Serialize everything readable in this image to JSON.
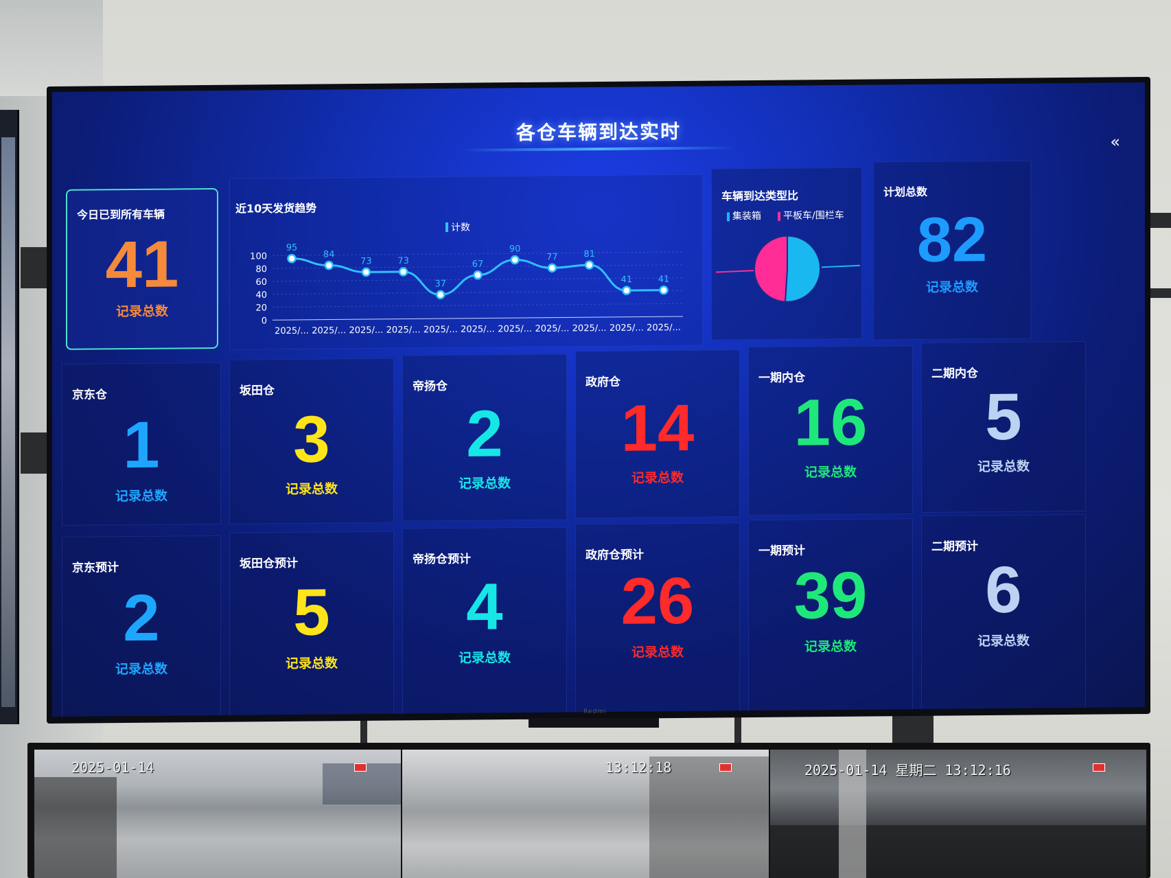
{
  "dashboard": {
    "title": "各仓车辆到达实时",
    "collapse_glyph": "«",
    "tv_brand": "Redmi"
  },
  "today": {
    "title": "今日已到所有车辆",
    "value": "41",
    "label": "记录总数",
    "color": "#f58a3c"
  },
  "trend": {
    "title": "近10天发货趋势",
    "legend": "计数",
    "line_color": "#2fc0ff"
  },
  "chart_data": {
    "type": "line",
    "title": "近10天发货趋势",
    "categories": [
      "2025/...",
      "2025/...",
      "2025/...",
      "2025/...",
      "2025/...",
      "2025/...",
      "2025/...",
      "2025/...",
      "2025/...",
      "2025/...",
      "2025/..."
    ],
    "series": [
      {
        "name": "计数",
        "values": [
          95,
          84,
          73,
          73,
          37,
          67,
          90,
          77,
          81,
          41,
          41
        ]
      }
    ],
    "ylim": [
      0,
      100
    ],
    "yticks": [
      0,
      20,
      40,
      60,
      80,
      100
    ],
    "grid": true,
    "legend_position": "top-center"
  },
  "pie": {
    "title": "车辆到达类型比",
    "legend": [
      {
        "label": "集装箱",
        "color": "#1ab8f0"
      },
      {
        "label": "平板车/围栏车",
        "color": "#ff2d95"
      }
    ],
    "values": [
      {
        "label": "集装箱",
        "value": 0.51
      },
      {
        "label": "平板车/围栏车",
        "value": 0.49
      }
    ]
  },
  "plan_total": {
    "title": "计划总数",
    "value": "82",
    "label": "记录总数",
    "color": "#1e9bff"
  },
  "warehouses": [
    {
      "title": "京东仓",
      "value": "1",
      "label": "记录总数",
      "color": "#1ea6ff"
    },
    {
      "title": "坂田仓",
      "value": "3",
      "label": "记录总数",
      "color": "#ffe41a"
    },
    {
      "title": "帝扬仓",
      "value": "2",
      "label": "记录总数",
      "color": "#17e6e6"
    },
    {
      "title": "政府仓",
      "value": "14",
      "label": "记录总数",
      "color": "#ff2a2a"
    },
    {
      "title": "一期内仓",
      "value": "16",
      "label": "记录总数",
      "color": "#1ee87a"
    },
    {
      "title": "二期内仓",
      "value": "5",
      "label": "记录总数",
      "color": "#bcd2f2"
    }
  ],
  "forecasts": [
    {
      "title": "京东预计",
      "value": "2",
      "label": "记录总数",
      "color": "#1ea6ff"
    },
    {
      "title": "坂田仓预计",
      "value": "5",
      "label": "记录总数",
      "color": "#ffe41a"
    },
    {
      "title": "帝扬仓预计",
      "value": "4",
      "label": "记录总数",
      "color": "#17e6e6"
    },
    {
      "title": "政府仓预计",
      "value": "26",
      "label": "记录总数",
      "color": "#ff2a2a"
    },
    {
      "title": "一期预计",
      "value": "39",
      "label": "记录总数",
      "color": "#1ee87a"
    },
    {
      "title": "二期预计",
      "value": "6",
      "label": "记录总数",
      "color": "#bcd2f2"
    }
  ],
  "cameras": [
    {
      "stamp": "2025-01-14"
    },
    {
      "stamp": "13:12:18"
    },
    {
      "stamp": "2025-01-14 星期二 13:12:16"
    }
  ]
}
